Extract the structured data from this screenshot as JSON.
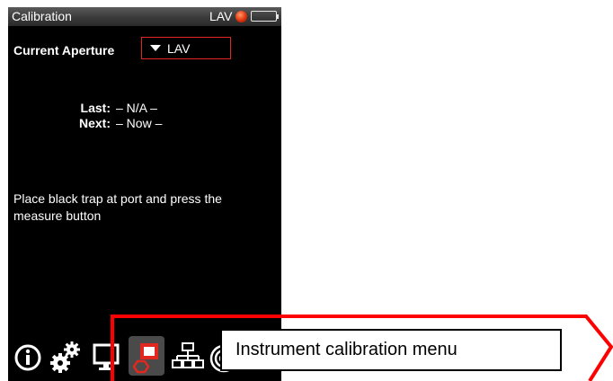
{
  "status_bar": {
    "title": "Calibration",
    "aperture": "LAV",
    "led_color": "#e0320d"
  },
  "aperture": {
    "label": "Current Aperture",
    "selected": "LAV"
  },
  "schedule": {
    "last_label": "Last:",
    "last_value": "– N/A –",
    "next_label": "Next:",
    "next_value": "– Now –"
  },
  "message": "Place black trap at port and press the measure button",
  "toolbar": {
    "items": [
      {
        "icon": "info-icon"
      },
      {
        "icon": "settings-gears-icon"
      },
      {
        "icon": "monitor-icon"
      },
      {
        "icon": "calibration-icon",
        "active": true
      },
      {
        "icon": "network-icon"
      },
      {
        "icon": "aperture-target-icon"
      }
    ]
  },
  "callout": {
    "text": "Instrument calibration menu",
    "color": "#ff0000"
  }
}
